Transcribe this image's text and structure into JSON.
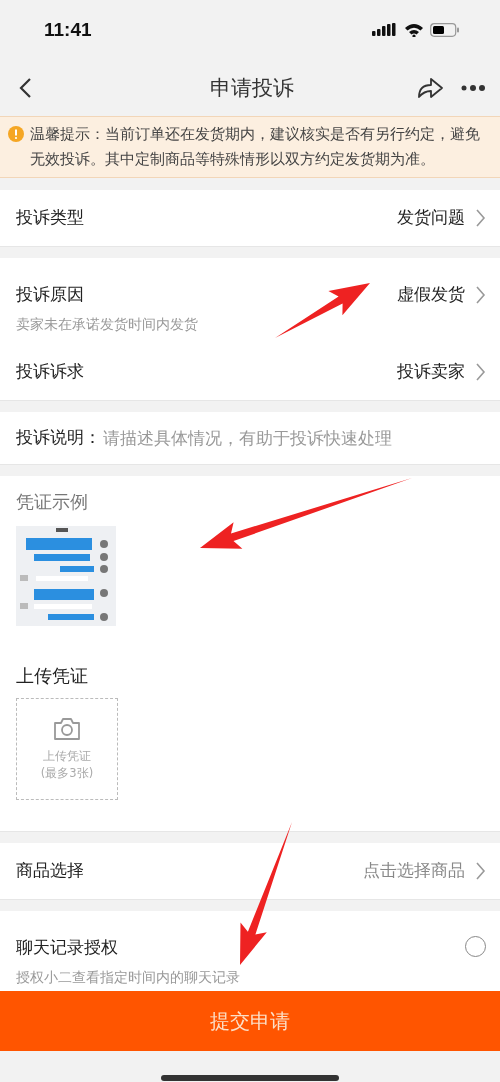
{
  "status_bar": {
    "time": "11:41"
  },
  "nav": {
    "title": "申请投诉"
  },
  "notice": {
    "label": "温馨提示：",
    "text": "当前订单还在发货期内，建议核实是否有另行约定，避免无效投诉。其中定制商品等特殊情形以双方约定发货期为准。"
  },
  "type_row": {
    "label": "投诉类型",
    "value": "发货问题"
  },
  "reason_row": {
    "label": "投诉原因",
    "value": "虚假发货",
    "hint": "卖家未在承诺发货时间内发货"
  },
  "demand_row": {
    "label": "投诉诉求",
    "value": "投诉卖家"
  },
  "description": {
    "label": "投诉说明：",
    "placeholder": "请描述具体情况，有助于投诉快速处理"
  },
  "example": {
    "title": "凭证示例"
  },
  "upload": {
    "title": "上传凭证",
    "button_label": "上传凭证",
    "button_note": "(最多3张)"
  },
  "product_row": {
    "label": "商品选择",
    "placeholder": "点击选择商品"
  },
  "chat_auth": {
    "label": "聊天记录授权",
    "hint": "授权小二查看指定时间内的聊天记录",
    "checked": false
  },
  "submit": {
    "label": "提交申请"
  },
  "annotations": [
    {
      "kind": "arrow"
    },
    {
      "kind": "arrow"
    },
    {
      "kind": "arrow"
    }
  ]
}
